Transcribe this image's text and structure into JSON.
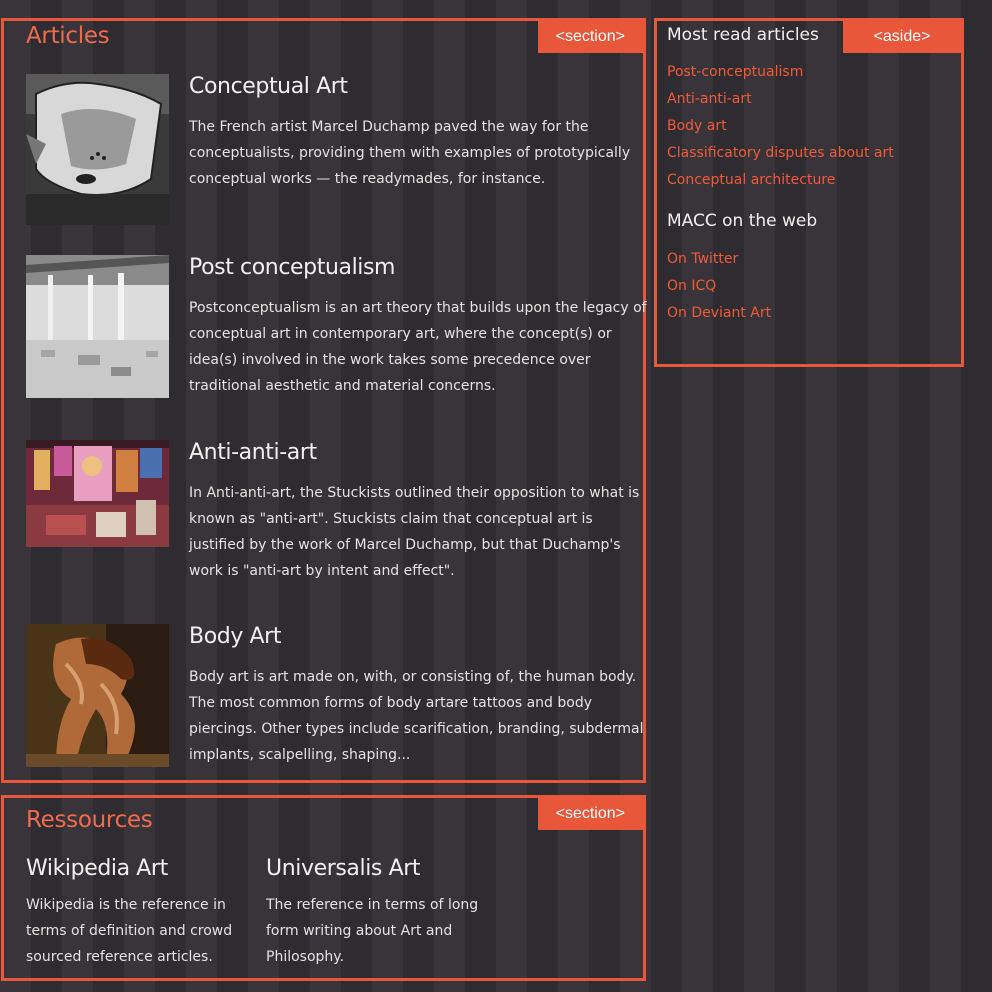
{
  "articles_section": {
    "title": "Articles",
    "tag": "<section>",
    "items": [
      {
        "title": "Conceptual Art",
        "text": "The French artist Marcel Duchamp paved the way for the conceptualists, providing them with examples of prototypically conceptual works — the readymades, for instance."
      },
      {
        "title": "Post conceptualism",
        "text": "Postconceptualism is an art theory that builds upon the legacy of conceptual art in contemporary art, where the concept(s) or idea(s) involved in the work takes some precedence over traditional aesthetic and material concerns."
      },
      {
        "title": "Anti-anti-art",
        "text": "In Anti-anti-art, the Stuckists outlined their opposition to what is known as \"anti-art\". Stuckists claim that conceptual art is justified by the work of Marcel Duchamp, but that Duchamp's work is \"anti-art by intent and effect\"."
      },
      {
        "title": "Body Art",
        "text": "Body art is art made on, with, or consisting of, the human body. The most common forms of body artare tattoos and body piercings. Other types include scarification, branding, subdermal implants, scalpelling, shaping..."
      }
    ]
  },
  "resources_section": {
    "title": "Ressources",
    "tag": "<section>",
    "items": [
      {
        "title": "Wikipedia Art",
        "text": "Wikipedia is the reference in terms of definition and crowd sourced reference articles."
      },
      {
        "title": "Universalis Art",
        "text": "The reference in terms of long form writing about Art and Philosophy."
      }
    ]
  },
  "aside": {
    "tag": "<aside>",
    "most_read_heading": "Most read articles",
    "most_read": [
      "Post-conceptualism",
      "Anti-anti-art",
      "Body art",
      "Classificatory disputes about art",
      "Conceptual architecture"
    ],
    "web_heading": "MACC on the web",
    "web_links": [
      "On Twitter",
      "On ICQ",
      "On Deviant Art"
    ]
  },
  "colors": {
    "accent": "#e8573a",
    "link": "#ef5a3c",
    "background": "#38343a",
    "stripe": "#2f2c31"
  },
  "icons": [
    "fountain-sculpture-image",
    "gallery-installation-image",
    "stuckist-paintings-image",
    "body-paint-image"
  ]
}
